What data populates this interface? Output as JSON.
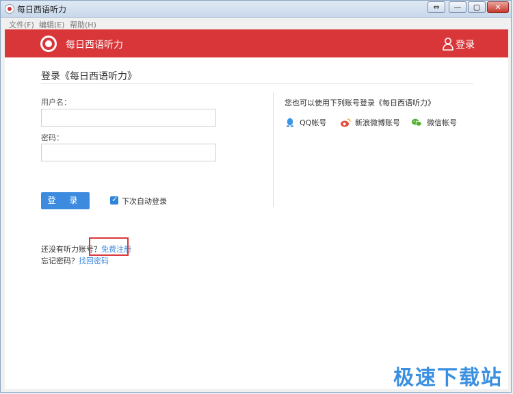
{
  "window": {
    "title": "每日西语听力",
    "buttons": {
      "swap": "⇔",
      "minimize": "—",
      "maximize": "▢",
      "close": "✕"
    }
  },
  "menu": {
    "items": [
      "文件(F)",
      "编辑(E)",
      "帮助(H)"
    ]
  },
  "header": {
    "brand": "每日西语听力",
    "login_label": "登录",
    "bg_color": "#d9363a"
  },
  "form": {
    "title": "登录《每日西语听力》",
    "username_label": "用户名：",
    "username_value": "",
    "password_label": "密码：",
    "password_value": "",
    "submit_label": "登 录",
    "remember_label": "下次自动登录",
    "remember_checked": true
  },
  "alt_login": {
    "title": "您也可以使用下列账号登录《每日西语听力》",
    "providers": [
      {
        "label": "QQ帐号",
        "icon": "qq-icon"
      },
      {
        "label": "新浪微博账号",
        "icon": "weibo-icon"
      },
      {
        "label": "微信帐号",
        "icon": "wechat-icon"
      }
    ]
  },
  "links": {
    "no_account_text": "还没有听力账号？",
    "register_link": "免费注册",
    "forgot_text": "忘记密码？",
    "recover_link": "找回密码"
  },
  "watermark": "极速下载站",
  "colors": {
    "accent": "#3d8bdf",
    "header": "#d9363a"
  }
}
